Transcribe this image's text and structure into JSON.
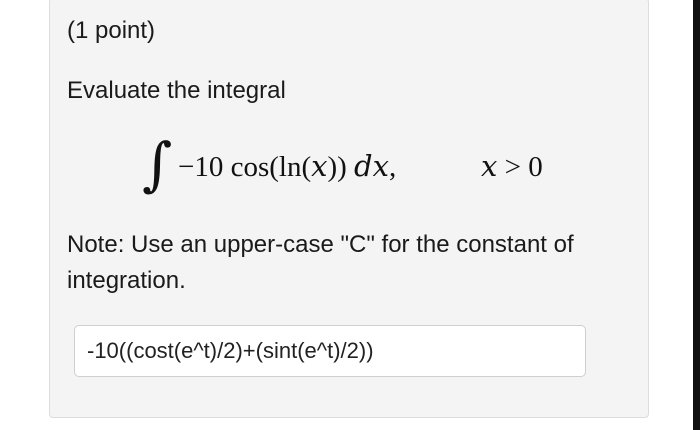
{
  "problem": {
    "points": "(1 point)",
    "prompt": "Evaluate the integral",
    "integral_sign": "∫",
    "integrand": "−10 cos(ln(𝑥)) 𝑑𝑥,",
    "condition": "𝑥 > 0",
    "note": "Note: Use an upper-case \"C\" for the constant of integration."
  },
  "answer": {
    "value": "-10((cost(e^t)/2)+(sint(e^t)/2))"
  },
  "colors": {
    "panel_background": "#f4f4f4",
    "panel_border": "#dcdcdc",
    "text": "#1a1a1a"
  }
}
